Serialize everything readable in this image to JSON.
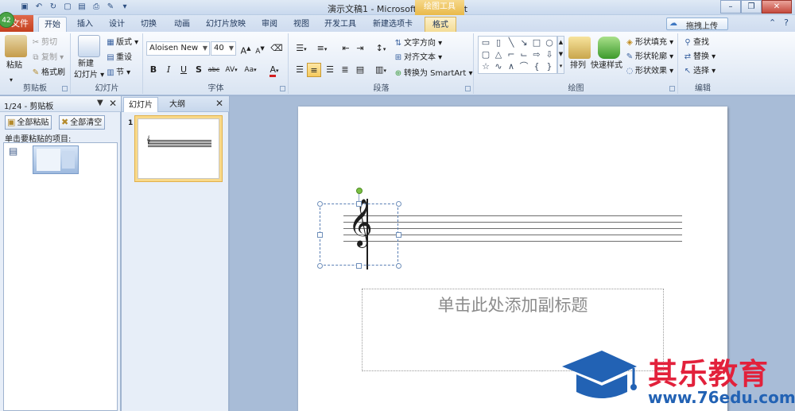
{
  "window": {
    "title": "演示文稿1 - Microsoft PowerPoint",
    "context_tab_title": "绘图工具",
    "minimize": "–",
    "restore": "❐",
    "close": "✕"
  },
  "badge": "42",
  "tabs": {
    "file": "文件",
    "home": "开始",
    "insert": "插入",
    "design": "设计",
    "transitions": "切换",
    "animations": "动画",
    "slideshow": "幻灯片放映",
    "review": "审阅",
    "view": "视图",
    "developer": "开发工具",
    "new_tab": "新建选项卡",
    "format": "格式"
  },
  "upload_button": "拖拽上传",
  "ribbon": {
    "clipboard": {
      "label": "剪贴板",
      "paste": "粘贴",
      "cut": "剪切",
      "copy": "复制",
      "format_painter": "格式刷"
    },
    "slides": {
      "label": "幻灯片",
      "new_slide_line1": "新建",
      "new_slide_line2": "幻灯片",
      "layout": "版式",
      "reset": "重设",
      "section": "节"
    },
    "font": {
      "label": "字体",
      "font_name": "Aloisen New",
      "font_size": "40",
      "grow": "A",
      "shrink": "A",
      "bold": "B",
      "italic": "I",
      "underline": "U",
      "shadow": "S",
      "strike": "abc",
      "spacing": "AV",
      "case": "Aa",
      "color": "A"
    },
    "paragraph": {
      "label": "段落",
      "text_direction": "文字方向",
      "align_text": "对齐文本",
      "smartart": "转换为 SmartArt"
    },
    "drawing": {
      "label": "绘图",
      "arrange": "排列",
      "quick_styles": "快速样式",
      "shape_fill": "形状填充",
      "shape_outline": "形状轮廓",
      "shape_effects": "形状效果"
    },
    "editing": {
      "label": "编辑",
      "find": "查找",
      "replace": "替换",
      "select": "选择"
    }
  },
  "clipboard_pane": {
    "title": "1/24 - 剪贴板",
    "paste_all": "全部粘贴",
    "clear_all": "全部清空",
    "hint": "单击要粘贴的项目:"
  },
  "slides_pane": {
    "tab_slides": "幻灯片",
    "tab_outline": "大纲",
    "slide_number": "1"
  },
  "slide": {
    "subtitle_placeholder": "单击此处添加副标题",
    "clef_symbol": "𝄞"
  },
  "watermark": {
    "brand": "其乐教育",
    "url": "www.76edu.com"
  },
  "colors": {
    "file_tab": "#c4401f",
    "watermark_red": "#e2213b",
    "watermark_blue": "#2262b4",
    "context_tab": "#e9b94a"
  }
}
